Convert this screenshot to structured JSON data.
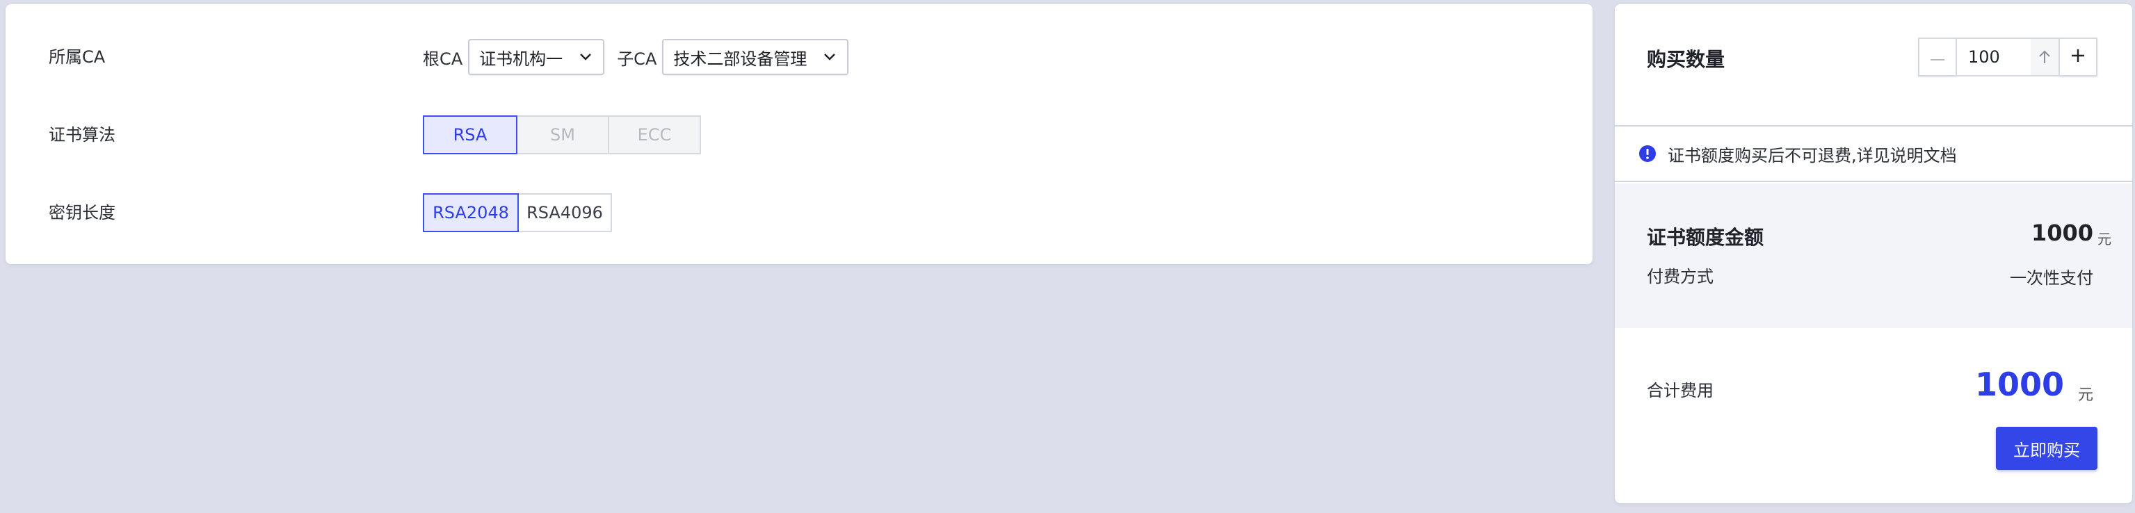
{
  "config": {
    "ca": {
      "label": "所属CA",
      "root_label": "根CA",
      "root_value": "证书机构一",
      "sub_label": "子CA",
      "sub_value": "技术二部设备管理"
    },
    "algorithm": {
      "label": "证书算法",
      "options": [
        "RSA",
        "SM",
        "ECC"
      ],
      "selected": "RSA"
    },
    "key_length": {
      "label": "密钥长度",
      "options": [
        "RSA2048",
        "RSA4096"
      ],
      "selected": "RSA2048"
    }
  },
  "purchase": {
    "quantity_label": "购买数量",
    "quantity_value": "100",
    "notice": "证书额度购买后不可退费,详见说明文档",
    "amount_label": "证书额度金额",
    "amount_value": "1000",
    "amount_unit": "元",
    "payment_label": "付费方式",
    "payment_value": "一次性支付",
    "total_label": "合计费用",
    "total_value": "1000",
    "total_unit": "元",
    "buy_button": "立即购买"
  },
  "colors": {
    "accent": "#3346e8",
    "background": "#dcdfeb",
    "selected_bg": "#e6e9ff"
  },
  "icons": [
    "chevron-down-icon",
    "minus-icon",
    "plus-icon",
    "arrow-up-icon",
    "info-icon"
  ]
}
